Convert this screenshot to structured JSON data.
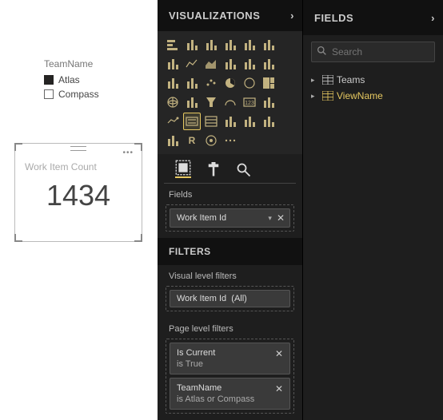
{
  "canvas": {
    "legend_title": "TeamName",
    "legend_items": [
      "Atlas",
      "Compass"
    ],
    "card_title": "Work Item Count",
    "card_value": "1434",
    "chart_data": {
      "type": "table",
      "title": "Work Item Count",
      "values": [
        1434
      ]
    }
  },
  "viz": {
    "header": "VISUALIZATIONS",
    "fields_label": "Fields",
    "field_pill": "Work Item Id",
    "filters_header": "FILTERS",
    "visual_filters_label": "Visual level filters",
    "visual_filter_name": "Work Item Id",
    "visual_filter_scope": "(All)",
    "page_filters_label": "Page level filters",
    "page_filters": [
      {
        "name": "Is Current",
        "cond": "is True"
      },
      {
        "name": "TeamName",
        "cond": "is Atlas or Compass"
      }
    ],
    "icons": [
      "stacked-bar",
      "stacked-column",
      "clustered-bar",
      "clustered-column",
      "hundred-bar",
      "hundred-column",
      "clustered-bar2",
      "line",
      "area",
      "stacked-area",
      "line-stacked",
      "line-clustered",
      "ribbon",
      "waterfall",
      "scatter",
      "pie",
      "donut",
      "treemap",
      "map",
      "filled-map",
      "funnel",
      "gauge",
      "card",
      "multi-card",
      "kpi",
      "slicer",
      "table",
      "matrix",
      "r-visual",
      "r-script",
      "matrix2",
      "r",
      "arcgis",
      "more"
    ],
    "selected_icon_index": 25
  },
  "fields": {
    "header": "FIELDS",
    "search_placeholder": "Search",
    "tables": [
      {
        "name": "Teams",
        "highlight": false
      },
      {
        "name": "ViewName",
        "highlight": true
      }
    ]
  }
}
